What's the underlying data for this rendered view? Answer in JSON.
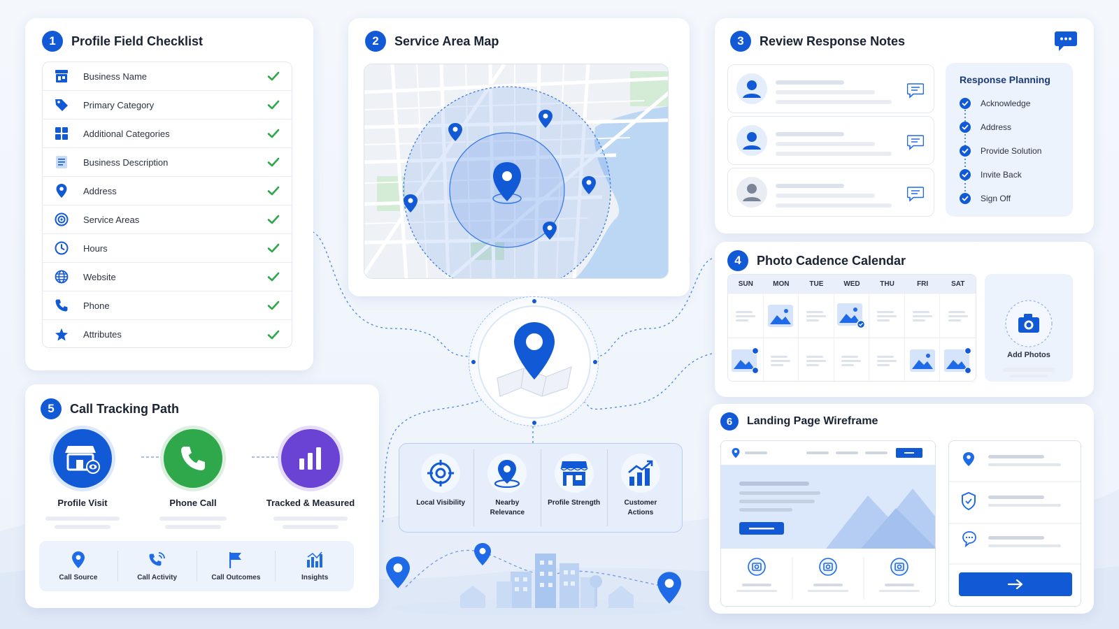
{
  "colors": {
    "accent": "#1259d6",
    "success": "#2ea84a",
    "purple": "#6a42d4",
    "panel": "#edf3fc"
  },
  "checklist": {
    "number": "1",
    "title": "Profile Field Checklist",
    "items": [
      {
        "label": "Business Name",
        "icon": "storefront-icon",
        "checked": true
      },
      {
        "label": "Primary Category",
        "icon": "tag-icon",
        "checked": true
      },
      {
        "label": "Additional Categories",
        "icon": "grid-icon",
        "checked": true
      },
      {
        "label": "Business Description",
        "icon": "document-icon",
        "checked": true
      },
      {
        "label": "Address",
        "icon": "pin-icon",
        "checked": true
      },
      {
        "label": "Service Areas",
        "icon": "target-icon",
        "checked": true
      },
      {
        "label": "Hours",
        "icon": "clock-icon",
        "checked": true
      },
      {
        "label": "Website",
        "icon": "globe-icon",
        "checked": true
      },
      {
        "label": "Phone",
        "icon": "phone-icon",
        "checked": true
      },
      {
        "label": "Attributes",
        "icon": "star-icon",
        "checked": true
      }
    ]
  },
  "service_map": {
    "number": "2",
    "title": "Service Area Map"
  },
  "reviews": {
    "number": "3",
    "title": "Review Response Notes",
    "planning_title": "Response Planning",
    "planning_steps": [
      "Acknowledge",
      "Address",
      "Provide Solution",
      "Invite Back",
      "Sign Off"
    ]
  },
  "calendar": {
    "number": "4",
    "title": "Photo Cadence Calendar",
    "days": [
      "SUN",
      "MON",
      "TUE",
      "WED",
      "THU",
      "FRI",
      "SAT"
    ],
    "add_photos_label": "Add Photos"
  },
  "call_tracking": {
    "number": "5",
    "title": "Call Tracking Path",
    "steps": [
      "Profile Visit",
      "Phone Call",
      "Tracked & Measured"
    ],
    "bar_items": [
      "Call Source",
      "Call Activity",
      "Call Outcomes",
      "Insights"
    ]
  },
  "hub_metrics": [
    "Local Visibility",
    "Nearby Relevance",
    "Profile Strength",
    "Customer Actions"
  ],
  "wireframe": {
    "number": "6",
    "title": "Landing Page Wireframe"
  }
}
